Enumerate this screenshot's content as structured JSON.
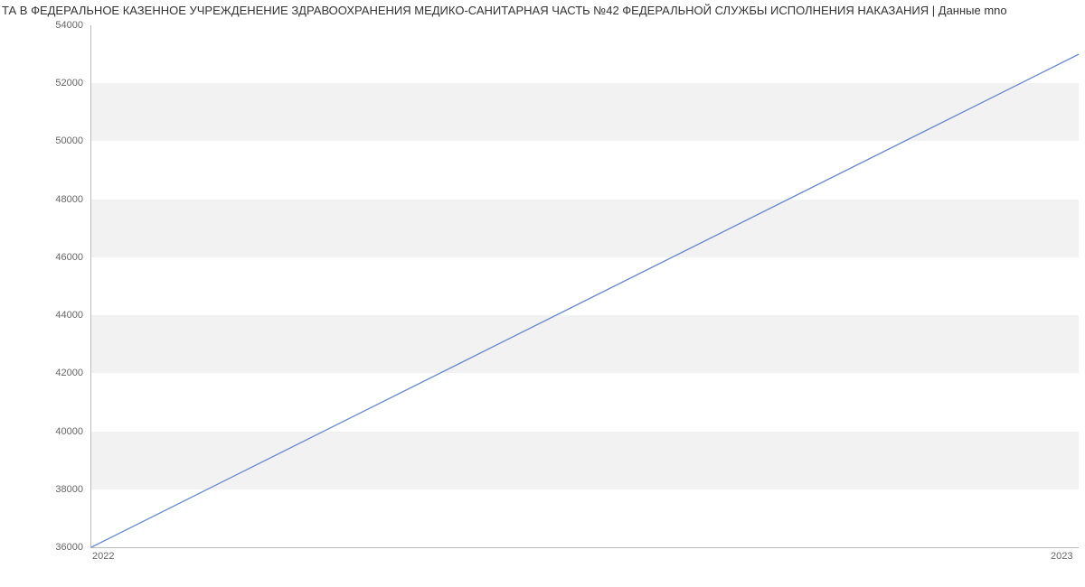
{
  "chart_data": {
    "type": "line",
    "title": "ТА В ФЕДЕРАЛЬНОЕ КАЗЕННОЕ УЧРЕЖДЕНЕНИЕ ЗДРАВООХРАНЕНИЯ МЕДИКО-САНИТАРНАЯ ЧАСТЬ №42 ФЕДЕРАЛЬНОЙ СЛУЖБЫ ИСПОЛНЕНИЯ НАКАЗАНИЯ | Данные mno",
    "xlabel": "",
    "ylabel": "",
    "x_categories": [
      "2022",
      "2023"
    ],
    "y_ticks": [
      36000,
      38000,
      40000,
      42000,
      44000,
      46000,
      48000,
      50000,
      52000,
      54000
    ],
    "ylim": [
      36000,
      54000
    ],
    "series": [
      {
        "name": "value",
        "color": "#6b8fd4",
        "x": [
          "2022",
          "2023"
        ],
        "values": [
          36000,
          53000
        ]
      }
    ]
  }
}
